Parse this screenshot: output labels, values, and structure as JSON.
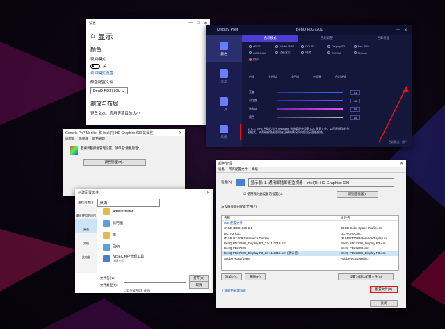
{
  "settings": {
    "window_title": "设置",
    "header": "显示",
    "color_section": "颜色",
    "night_light_label": "夜间模式",
    "night_light_state": "关",
    "night_light_settings_link": "夜间模式设置",
    "color_profile_label": "颜色配置文件",
    "color_profile_value": "BenQ PD2720U",
    "scale_section": "缩放与布局",
    "scale_desc": "更改文本、应用等项目的大小"
  },
  "pilot": {
    "title": "Display Pilot",
    "monitor": "BenQ PD2720U",
    "side": [
      "颜色",
      "显示",
      "工具",
      "系统"
    ],
    "tabs": [
      "色彩模式",
      "色彩调整",
      "色彩校准"
    ],
    "radios": [
      "sRGB",
      "Adobe RGB",
      "DCI-P3",
      "Display P3",
      "Rec.709",
      "CAD/CAM",
      "动画渲染",
      "暗房",
      "DICOM",
      "M-book",
      "用户"
    ],
    "row2": [
      "色温",
      "全模拟",
      "冷色调",
      "中全景",
      "色彩增强"
    ],
    "sliders": [
      {
        "label": "亮度",
        "value": "51",
        "color": "#3a6bff"
      },
      {
        "label": "对比度",
        "value": "48",
        "color": "#6a5cff"
      },
      {
        "label": "饱和度",
        "value": "55",
        "color": "#c050ff"
      },
      {
        "label": "黑色",
        "value": "10",
        "color": "#7a7fb0"
      }
    ],
    "icc_text": "ICC Sync 启动后当在 Windows 系统管理中设置 ICC 配置文件，以匹配所用的色彩模式，从而确保色彩管理在正确的情况下向您显示面板颜色。",
    "footer": "色彩模式 · 用户"
  },
  "cm1": {
    "title": "Generic PnP Monitor 和 Intel(R) HD Graphics 630 的属性",
    "menu": [
      "适配器",
      "监视器",
      "颜色管理"
    ],
    "text": "若要调整颜色管理设置，请单击\"颜色管理\"。",
    "button": "颜色管理(M)..."
  },
  "fd": {
    "title": "创建配置文件",
    "lookin": "查找范围(I):",
    "lookin_value": "桌面",
    "left": [
      "最近使用的项目",
      "桌面",
      "文档",
      "此电脑"
    ],
    "items": [
      "Administrator",
      "此电脑",
      "库",
      "网络",
      "NISEC用户管理工具"
    ],
    "item_sub": "快捷方式",
    "filename_label": "文件名(N):",
    "filetype_label": "文件类型(T):",
    "open": "打开(O)",
    "cancel": "取消",
    "readonly": "以只读方式打开(R)"
  },
  "cm2": {
    "title": "颜色管理",
    "tabs": [
      "设备",
      "所有配置文件",
      "高级"
    ],
    "device_label": "设备(D):",
    "device_value": "显示器: 1. 通用即插即用监视器 - Intel(R) HD Graphics 630",
    "use_my_settings": "使用我对此设备的设置(U)",
    "identify": "识别监视器(I)",
    "profiles_header": "与设备关联的配置文件(F):",
    "col_name": "名称",
    "col_file": "文件名",
    "rows": [
      [
        "ICC 配置文件",
        ""
      ],
      [
        "sRGB IEC61966-2.1",
        "sRGB Color Space Profile.icm"
      ],
      [
        "DCI P3 (DC)",
        "DCI-P3-DC.icc"
      ],
      [
        "ITU-R BT.709 Reference Display",
        "ITU-RBT709ReferenceDisplay.icc"
      ],
      [
        "BenQ PD2720U_Display P3_23-11-2018.icm",
        "BenQ PD2720U_Display P3.icm"
      ],
      [
        "BenQ PD2720U",
        "BenQ PD2720U.icm"
      ],
      [
        "BenQ PD2720U_Display P3_23-11-2018.icm (默认值)",
        "BenQ PD2720U_Display P3.icm"
      ],
      [
        "Adobe RGB (1998)",
        "AdobeRGB1998.icc"
      ]
    ],
    "add": "添加(A)...",
    "remove": "删除(R)",
    "set_default": "设置为默认配置文件(S)",
    "profiles_btn": "配置文件(O)",
    "link": "了解颜色管理设置",
    "close": "关闭"
  }
}
